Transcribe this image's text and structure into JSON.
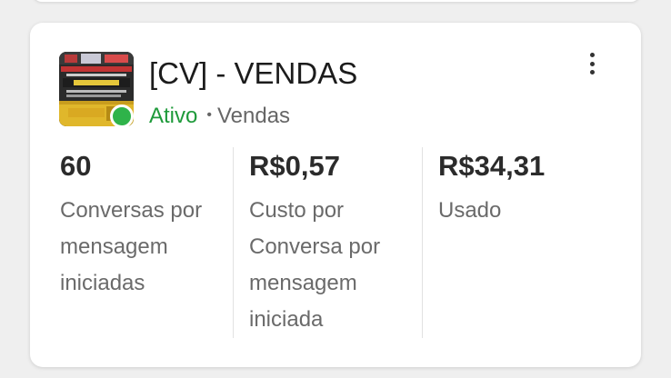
{
  "campaign": {
    "title": "[CV] - VENDAS",
    "status": "Ativo",
    "separator": "•",
    "objective": "Vendas",
    "status_color": "#2fb34a",
    "thumbnail_icon": "ad-creative-thumbnail"
  },
  "metrics": [
    {
      "value": "60",
      "label": "Conversas por mensagem iniciadas"
    },
    {
      "value": "R$0,57",
      "label": "Custo por Conversa por mensagem iniciada"
    },
    {
      "value": "R$34,31",
      "label": "Usado"
    }
  ]
}
